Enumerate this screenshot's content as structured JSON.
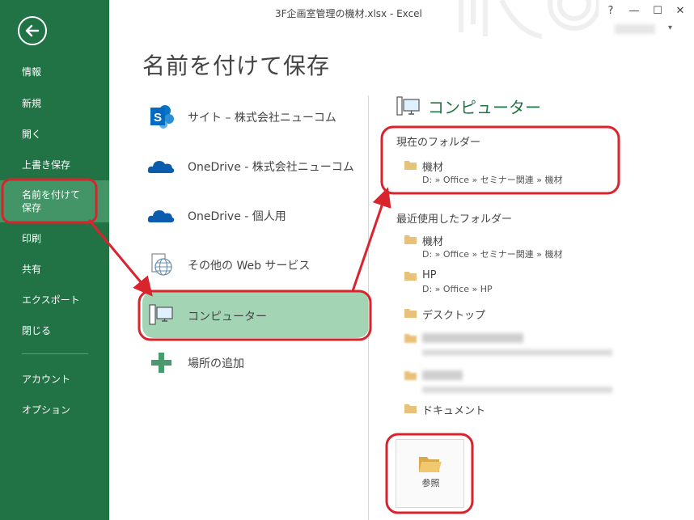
{
  "window": {
    "title": "3F企画室管理の機材.xlsx - Excel",
    "help": "?",
    "minimize": "—",
    "maximize": "☐",
    "close": "✕",
    "user_caret": "▾"
  },
  "sidebar": {
    "items": [
      {
        "label": "情報"
      },
      {
        "label": "新規"
      },
      {
        "label": "開く"
      },
      {
        "label": "上書き保存"
      },
      {
        "label_line1": "名前を付けて",
        "label_line2": "保存"
      },
      {
        "label": "印刷"
      },
      {
        "label": "共有"
      },
      {
        "label": "エクスポート"
      },
      {
        "label": "閉じる"
      },
      {
        "label": "アカウント"
      },
      {
        "label": "オプション"
      }
    ]
  },
  "page_title": "名前を付けて保存",
  "places": [
    {
      "label": "サイト – 株式会社ニューコム",
      "icon": "sharepoint-icon"
    },
    {
      "label": "OneDrive - 株式会社ニューコム",
      "icon": "onedrive-cloud-icon"
    },
    {
      "label": "OneDrive - 個人用",
      "icon": "onedrive-cloud-icon"
    },
    {
      "label": "その他の Web サービス",
      "icon": "web-globe-icon"
    },
    {
      "label": "コンピューター",
      "icon": "computer-icon",
      "selected": true
    },
    {
      "label": "場所の追加",
      "icon": "plus-icon"
    }
  ],
  "computer_panel": {
    "heading": "コンピューター",
    "current_folder_title": "現在のフォルダー",
    "current_folder": {
      "name": "機材",
      "path": "D: » Office » セミナー関連 » 機材"
    },
    "recent_title": "最近使用したフォルダー",
    "recent_folders": [
      {
        "name": "機材",
        "path": "D: » Office » セミナー関連 » 機材"
      },
      {
        "name": "HP",
        "path": "D: » Office » HP"
      },
      {
        "name": "デスクトップ",
        "path": ""
      },
      {
        "name": "",
        "path": "",
        "blurred": true
      },
      {
        "name": "",
        "path": "",
        "blurred": true
      },
      {
        "name": "ドキュメント",
        "path": ""
      }
    ],
    "browse_label": "参照"
  },
  "colors": {
    "excel_green": "#217346",
    "sidebar_selected": "#439467",
    "place_selected": "#a3d5b5",
    "annotation_red": "#d9232d",
    "folder": "#e8c27a"
  }
}
